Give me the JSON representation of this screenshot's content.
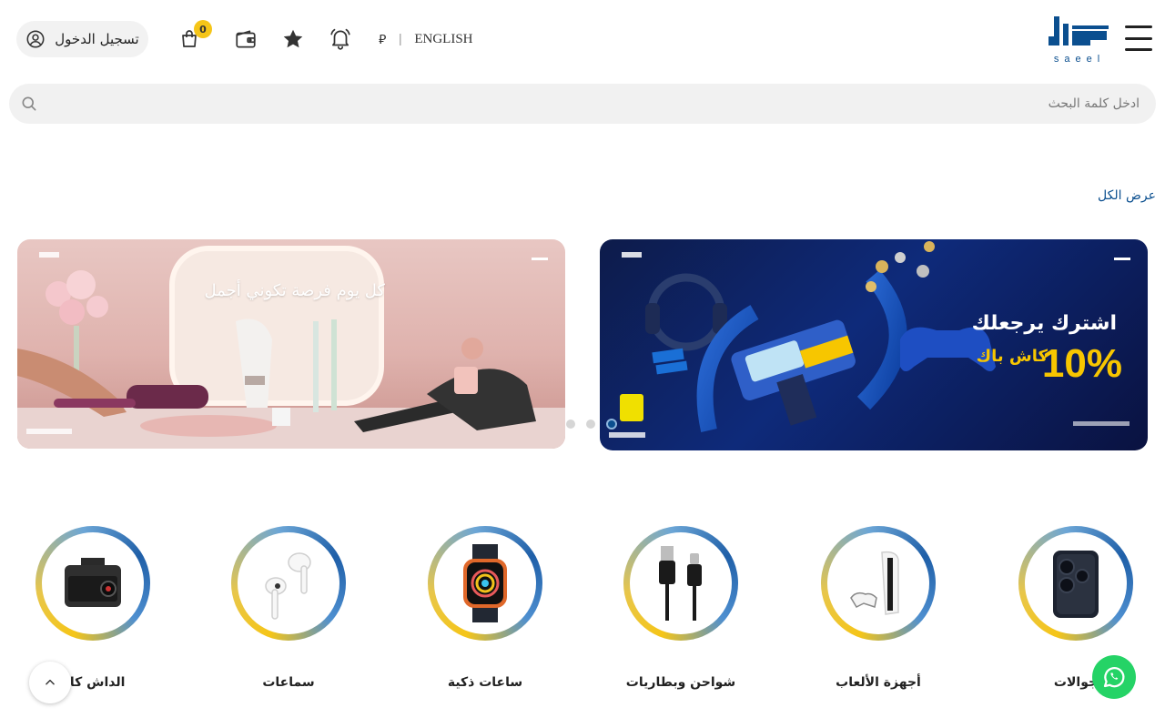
{
  "header": {
    "lang_label": "ENGLISH",
    "lang_separator": "|",
    "currency_symbol": "⃁",
    "cart_count": "0",
    "login_label": "تسجيل الدخول",
    "logo_text": "saeel"
  },
  "search": {
    "placeholder": "ادخل كلمة البحث"
  },
  "section": {
    "view_all": "عرض الكل"
  },
  "banners": [
    {
      "headline": "اشترك يرجعلك",
      "big": "10%",
      "sub": "كاش باك"
    },
    {
      "headline": "كل يوم فرصة تكوني أجمل"
    }
  ],
  "carousel": {
    "dots": 3,
    "active": 3
  },
  "categories": [
    {
      "label": "جوالات",
      "icon": "phone-icon"
    },
    {
      "label": "أجهزة الألعاب",
      "icon": "console-icon"
    },
    {
      "label": "شواحن وبطاريات",
      "icon": "cable-icon"
    },
    {
      "label": "ساعات ذكية",
      "icon": "smartwatch-icon"
    },
    {
      "label": "سماعات",
      "icon": "earbuds-icon"
    },
    {
      "label": "الداش كام",
      "icon": "dashcam-icon"
    }
  ],
  "colors": {
    "brand_blue": "#0b4f8f",
    "badge_yellow": "#f5c518",
    "whatsapp_green": "#25d366"
  }
}
